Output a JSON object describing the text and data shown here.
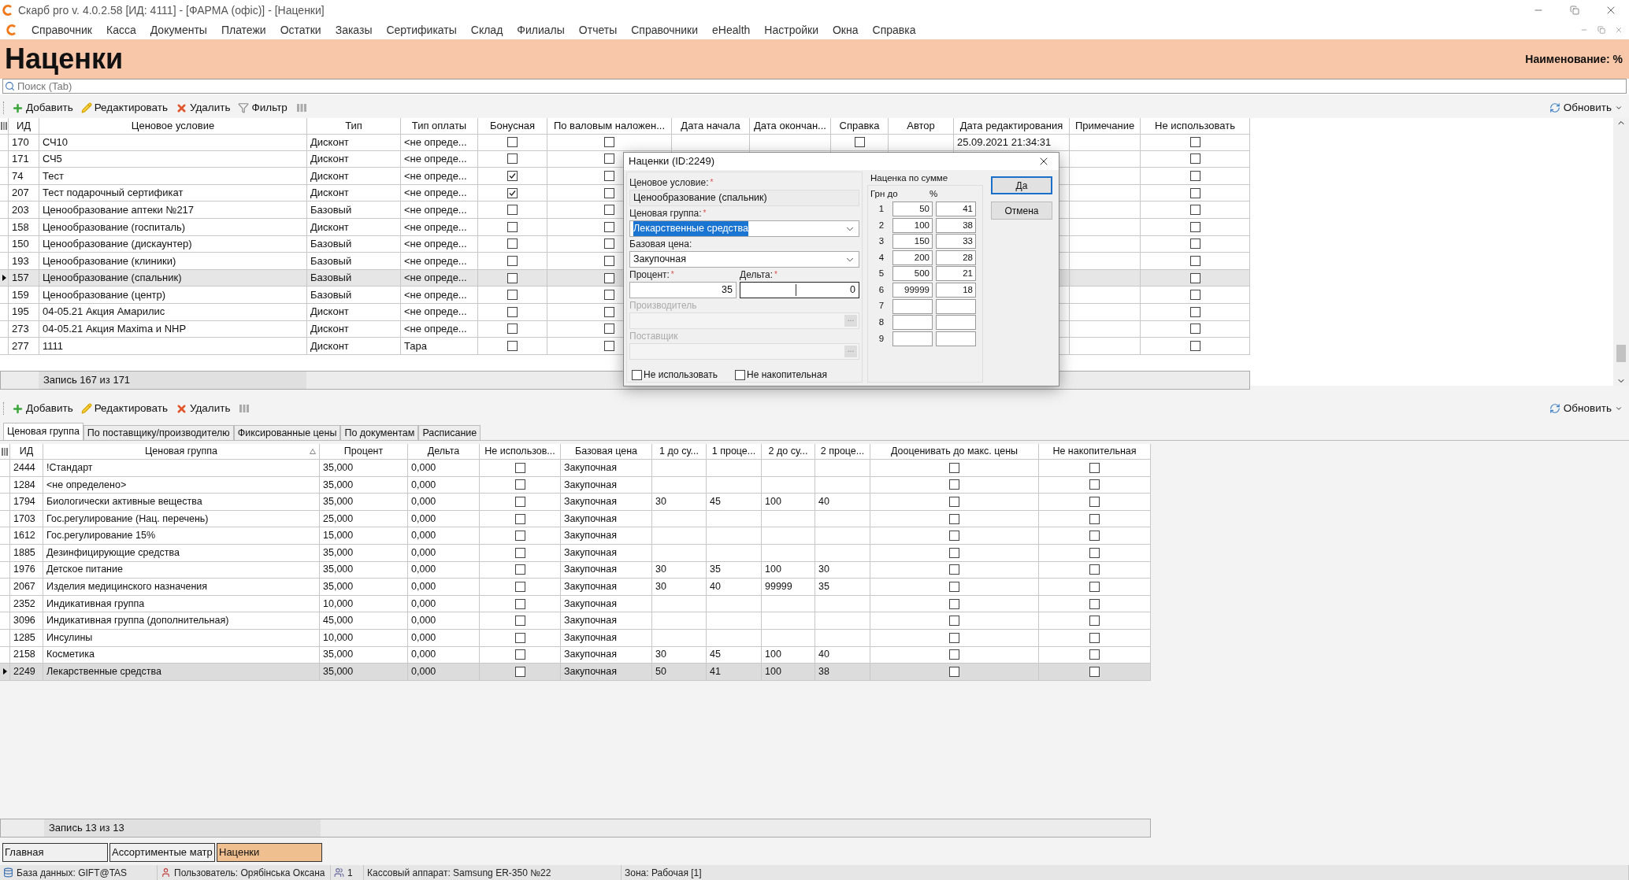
{
  "window": {
    "title": "Скарб pro v. 4.0.2.58 [ИД: 4111] - [ФАРМА (офіс)] - [Наценки]"
  },
  "menu": [
    "Справочник",
    "Касса",
    "Документы",
    "Платежи",
    "Остатки",
    "Заказы",
    "Сертификаты",
    "Склад",
    "Филиалы",
    "Отчеты",
    "Справочники",
    "eHealth",
    "Настройки",
    "Окна",
    "Справка"
  ],
  "header": {
    "title": "Наценки",
    "right_label": "Наименование: %"
  },
  "search": {
    "placeholder": "Поиск (Tab)"
  },
  "toolbar": {
    "buttons": [
      {
        "kind": "add",
        "label": "Добавить"
      },
      {
        "kind": "edit",
        "label": "Редактировать"
      },
      {
        "kind": "delete",
        "label": "Удалить"
      },
      {
        "kind": "filter",
        "label": "Фильтр"
      },
      {
        "kind": "columns"
      }
    ],
    "refresh": "Обновить"
  },
  "top_table": {
    "columns": [
      "ИД",
      "Ценовое условие",
      "Тип",
      "Тип оплаты",
      "Бонусная",
      "По валовым наложен...",
      "Дата начала",
      "Дата окончан...",
      "Справка",
      "Автор",
      "Дата редактирования",
      "Примечание",
      "Не использовать"
    ],
    "rows": [
      {
        "id": "170",
        "condition": "СЧ10",
        "type": "Дисконт",
        "payment": "<не опреде...",
        "bonus": false,
        "gross": false,
        "reference": false,
        "edited": "25.09.2021 21:34:31",
        "not_used": false,
        "selected": false
      },
      {
        "id": "171",
        "condition": "СЧ5",
        "type": "Дисконт",
        "payment": "<не опреде...",
        "bonus": false,
        "gross": false,
        "not_used": false,
        "selected": false
      },
      {
        "id": "74",
        "condition": "Тест",
        "type": "Дисконт",
        "payment": "<не опреде...",
        "bonus": true,
        "gross": false,
        "not_used": false,
        "selected": false
      },
      {
        "id": "207",
        "condition": "Тест подарочный сертификат",
        "type": "Дисконт",
        "payment": "<не опреде...",
        "bonus": true,
        "gross": false,
        "not_used": false,
        "selected": false
      },
      {
        "id": "203",
        "condition": "Ценообразование аптеки №217",
        "type": "Базовый",
        "payment": "<не опреде...",
        "bonus": false,
        "gross": false,
        "not_used": false,
        "selected": false
      },
      {
        "id": "158",
        "condition": "Ценообразование (госпиталь)",
        "type": "Дисконт",
        "payment": "<не опреде...",
        "bonus": false,
        "gross": false,
        "not_used": false,
        "selected": false
      },
      {
        "id": "150",
        "condition": "Ценообразование (дискаунтер)",
        "type": "Базовый",
        "payment": "<не опреде...",
        "bonus": false,
        "gross": false,
        "not_used": false,
        "selected": false
      },
      {
        "id": "193",
        "condition": "Ценообразование (клиники)",
        "type": "Базовый",
        "payment": "<не опреде...",
        "bonus": false,
        "gross": false,
        "not_used": false,
        "selected": false
      },
      {
        "id": "157",
        "condition": "Ценообразование (спальник)",
        "type": "Базовый",
        "payment": "<не опреде...",
        "bonus": false,
        "gross": false,
        "not_used": false,
        "selected": true
      },
      {
        "id": "159",
        "condition": "Ценообразование (центр)",
        "type": "Базовый",
        "payment": "<не опреде...",
        "bonus": false,
        "gross": false,
        "not_used": false,
        "selected": false
      },
      {
        "id": "195",
        "condition": "04-05.21 Акция Амарилис",
        "type": "Дисконт",
        "payment": "<не опреде...",
        "bonus": false,
        "gross": false,
        "not_used": false,
        "selected": false
      },
      {
        "id": "273",
        "condition": "04-05.21 Акция Maxima и NHP",
        "type": "Дисконт",
        "payment": "<не опреде...",
        "bonus": false,
        "gross": false,
        "not_used": false,
        "selected": false
      },
      {
        "id": "277",
        "condition": "1111",
        "type": "Дисконт",
        "payment": "Тара",
        "bonus": false,
        "gross": false,
        "not_used": false,
        "selected": false
      }
    ],
    "footer": "Запись 167 из 171"
  },
  "dialog": {
    "title": "Наценки (ID:2249)",
    "condition": {
      "label": "Ценовое условие:",
      "mark": "*",
      "value": "Ценообразование (спальник)",
      "readonly": true
    },
    "group": {
      "label": "Ценовая группа:",
      "mark": "*",
      "value": "Лекарственные средства",
      "highlighted": true
    },
    "base": {
      "label": "Базовая цена:",
      "value": "Закупочная"
    },
    "percent": {
      "label": "Процент:",
      "mark": "*",
      "value": "35",
      "focused": false
    },
    "delta": {
      "label": "Дельта:",
      "mark": "*",
      "value": "0",
      "focused": true
    },
    "lookups": [
      {
        "label": "Производитель",
        "button": "...",
        "disabled": true
      },
      {
        "label": "Поставщик",
        "button": "...",
        "disabled": true
      }
    ],
    "checkboxes": [
      {
        "label": "Не использовать",
        "checked": false
      },
      {
        "label": "Не накопительная",
        "checked": false
      }
    ],
    "sum_group": {
      "title": "Наценка по сумме",
      "headers": [
        "Грн до",
        "%"
      ],
      "rows": [
        {
          "n": "1",
          "upto": "50",
          "pct": "41"
        },
        {
          "n": "2",
          "upto": "100",
          "pct": "38"
        },
        {
          "n": "3",
          "upto": "150",
          "pct": "33"
        },
        {
          "n": "4",
          "upto": "200",
          "pct": "28"
        },
        {
          "n": "5",
          "upto": "500",
          "pct": "21"
        },
        {
          "n": "6",
          "upto": "99999",
          "pct": "18"
        },
        {
          "n": "7"
        },
        {
          "n": "8"
        },
        {
          "n": "9"
        }
      ]
    },
    "buttons": [
      {
        "label": "Да",
        "default": true
      },
      {
        "label": "Отмена",
        "default": false
      }
    ]
  },
  "bottom_toolbar": {
    "buttons": [
      {
        "kind": "add",
        "label": "Добавить"
      },
      {
        "kind": "edit",
        "label": "Редактировать"
      },
      {
        "kind": "delete",
        "label": "Удалить"
      },
      {
        "kind": "columns"
      }
    ],
    "refresh": "Обновить"
  },
  "tabs": [
    {
      "label": "Ценовая группа",
      "selected": true
    },
    {
      "label": "По поставщику/производителю",
      "selected": false
    },
    {
      "label": "Фиксированные цены",
      "selected": false
    },
    {
      "label": "По документам",
      "selected": false
    },
    {
      "label": "Расписание",
      "selected": false
    }
  ],
  "bottom_table": {
    "columns": [
      "ИД",
      "Ценовая группа",
      "Процент",
      "Дельта",
      "Не использов...",
      "Базовая цена",
      "1 до су...",
      "1 проце...",
      "2 до су...",
      "2 проце...",
      "Дооценивать до макс. цены",
      "Не накопительная"
    ],
    "rows": [
      {
        "id": "2444",
        "group": "!Стандарт",
        "percent": "35,000",
        "delta": "0,000",
        "not_used": false,
        "base": "Закупочная",
        "revalue": false,
        "non_cumulative": false,
        "selected": false
      },
      {
        "id": "1284",
        "group": "<не определено>",
        "percent": "35,000",
        "delta": "0,000",
        "not_used": false,
        "base": "Закупочная",
        "revalue": false,
        "non_cumulative": false,
        "selected": false
      },
      {
        "id": "1794",
        "group": "Биологически активные вещества",
        "percent": "35,000",
        "delta": "0,000",
        "not_used": false,
        "base": "Закупочная",
        "sum1": "30",
        "pct1": "45",
        "sum2": "100",
        "pct2": "40",
        "revalue": false,
        "non_cumulative": false,
        "selected": false
      },
      {
        "id": "1703",
        "group": "Гос.регулирование (Нац. перечень)",
        "percent": "25,000",
        "delta": "0,000",
        "not_used": false,
        "base": "Закупочная",
        "revalue": false,
        "non_cumulative": false,
        "selected": false
      },
      {
        "id": "1612",
        "group": "Гос.регулирование 15%",
        "percent": "15,000",
        "delta": "0,000",
        "not_used": false,
        "base": "Закупочная",
        "revalue": false,
        "non_cumulative": false,
        "selected": false
      },
      {
        "id": "1885",
        "group": "Дезинфицирующие средства",
        "percent": "35,000",
        "delta": "0,000",
        "not_used": false,
        "base": "Закупочная",
        "revalue": false,
        "non_cumulative": false,
        "selected": false
      },
      {
        "id": "1976",
        "group": "Детское питание",
        "percent": "35,000",
        "delta": "0,000",
        "not_used": false,
        "base": "Закупочная",
        "sum1": "30",
        "pct1": "35",
        "sum2": "100",
        "pct2": "30",
        "revalue": false,
        "non_cumulative": false,
        "selected": false
      },
      {
        "id": "2067",
        "group": "Изделия медицинского назначения",
        "percent": "35,000",
        "delta": "0,000",
        "not_used": false,
        "base": "Закупочная",
        "sum1": "30",
        "pct1": "40",
        "sum2": "99999",
        "pct2": "35",
        "revalue": false,
        "non_cumulative": false,
        "selected": false
      },
      {
        "id": "2352",
        "group": "Индикативная группа",
        "percent": "10,000",
        "delta": "0,000",
        "not_used": false,
        "base": "Закупочная",
        "revalue": false,
        "non_cumulative": false,
        "selected": false
      },
      {
        "id": "3096",
        "group": "Индикативная группа (дополнительная)",
        "percent": "45,000",
        "delta": "0,000",
        "not_used": false,
        "base": "Закупочная",
        "revalue": false,
        "non_cumulative": false,
        "selected": false
      },
      {
        "id": "1285",
        "group": "Инсулины",
        "percent": "10,000",
        "delta": "0,000",
        "not_used": false,
        "base": "Закупочная",
        "revalue": false,
        "non_cumulative": false,
        "selected": false
      },
      {
        "id": "2158",
        "group": "Косметика",
        "percent": "35,000",
        "delta": "0,000",
        "not_used": false,
        "base": "Закупочная",
        "sum1": "30",
        "pct1": "45",
        "sum2": "100",
        "pct2": "40",
        "revalue": false,
        "non_cumulative": false,
        "selected": false
      },
      {
        "id": "2249",
        "group": "Лекарственные средства",
        "percent": "35,000",
        "delta": "0,000",
        "not_used": false,
        "base": "Закупочная",
        "sum1": "50",
        "pct1": "41",
        "sum2": "100",
        "pct2": "38",
        "revalue": false,
        "non_cumulative": false,
        "selected": true
      }
    ],
    "footer": "Запись 13 из 13"
  },
  "window_tabs": [
    {
      "label": "Главная",
      "selected": false
    },
    {
      "label": "Ассортиментые матр",
      "selected": false
    },
    {
      "label": "Наценки",
      "selected": true
    }
  ],
  "status_bar": [
    {
      "kind": "database",
      "text": "База данных: GIFT@TAS"
    },
    {
      "kind": "user",
      "text": "Пользователь: Орябінська Оксана"
    },
    {
      "kind": "sessions",
      "text": "1"
    },
    {
      "kind": "register",
      "text": "Кассовый аппарат: Samsung ER-350 №22"
    },
    {
      "kind": "zone",
      "text": "Зона: Рабочая [1]"
    }
  ]
}
